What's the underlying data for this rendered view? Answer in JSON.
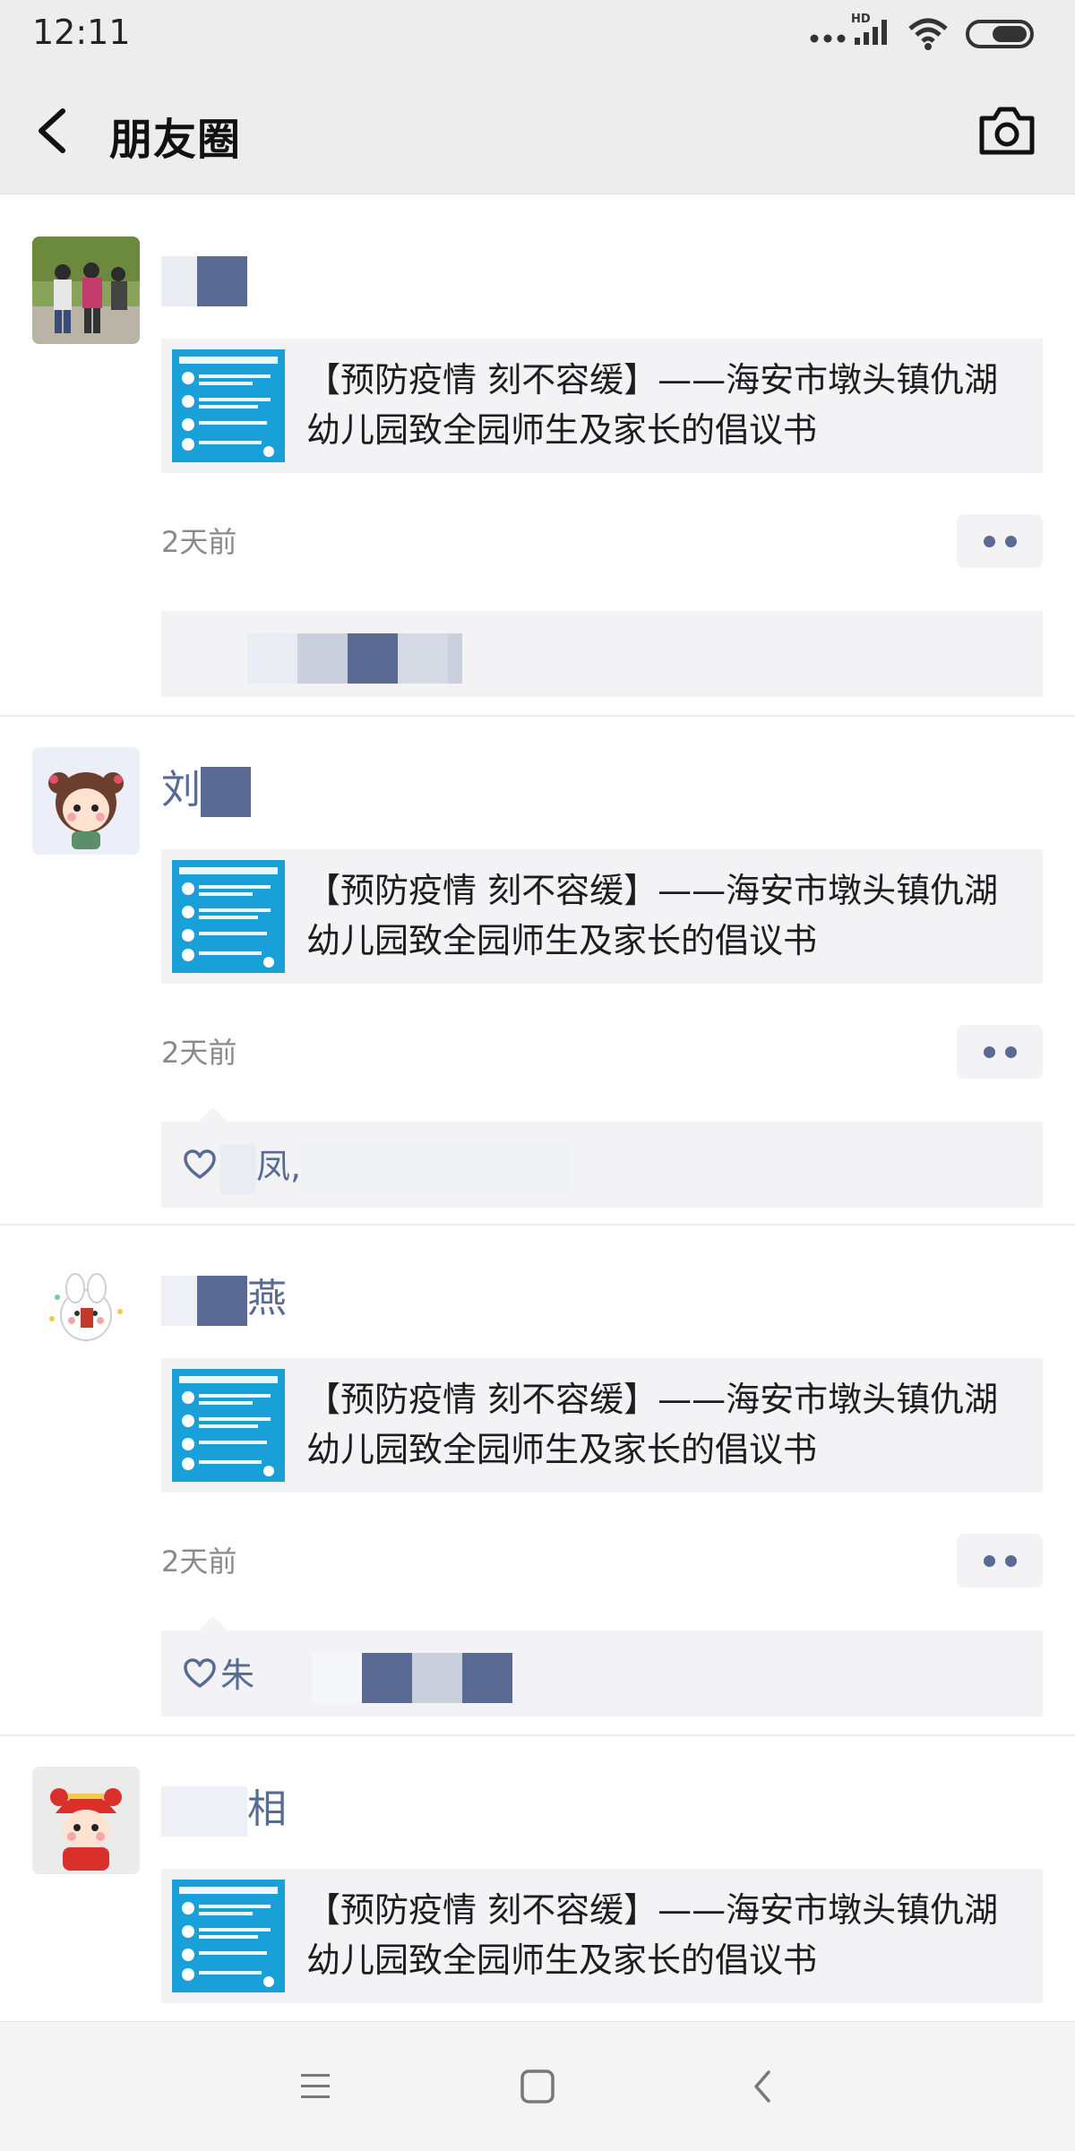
{
  "status_bar": {
    "time": "12:11",
    "icons": [
      "more-dots-icon",
      "hd-signal-icon",
      "wifi-icon",
      "battery-icon"
    ],
    "hd_label": "HD"
  },
  "header": {
    "back_icon": "chevron-left-icon",
    "title": "朋友圈",
    "camera_icon": "camera-icon"
  },
  "posts": [
    {
      "name": "",
      "link_title": "【预防疫情 刻不容缓】——海安市墩头镇仇湖幼儿园致全园师生及家长的倡议书",
      "time_ago": "2天前",
      "likes_text": ""
    },
    {
      "name": "刘",
      "link_title": "【预防疫情 刻不容缓】——海安市墩头镇仇湖幼儿园致全园师生及家长的倡议书",
      "time_ago": "2天前",
      "likes_text": "凤,"
    },
    {
      "name": "燕",
      "link_title": "【预防疫情 刻不容缓】——海安市墩头镇仇湖幼儿园致全园师生及家长的倡议书",
      "time_ago": "2天前",
      "likes_text": "朱"
    },
    {
      "name": "相",
      "link_title": "【预防疫情 刻不容缓】——海安市墩头镇仇湖幼儿园致全园师生及家长的倡议书",
      "time_ago": "",
      "likes_text": ""
    }
  ],
  "nav": {
    "icons": [
      "menu-icon",
      "home-square-icon",
      "back-triangle-icon"
    ]
  },
  "colors": {
    "link_blue": "#576b95",
    "header_bg": "#ededed",
    "card_bg": "#f3f3f5",
    "thumb_blue": "#1aa0d8"
  }
}
